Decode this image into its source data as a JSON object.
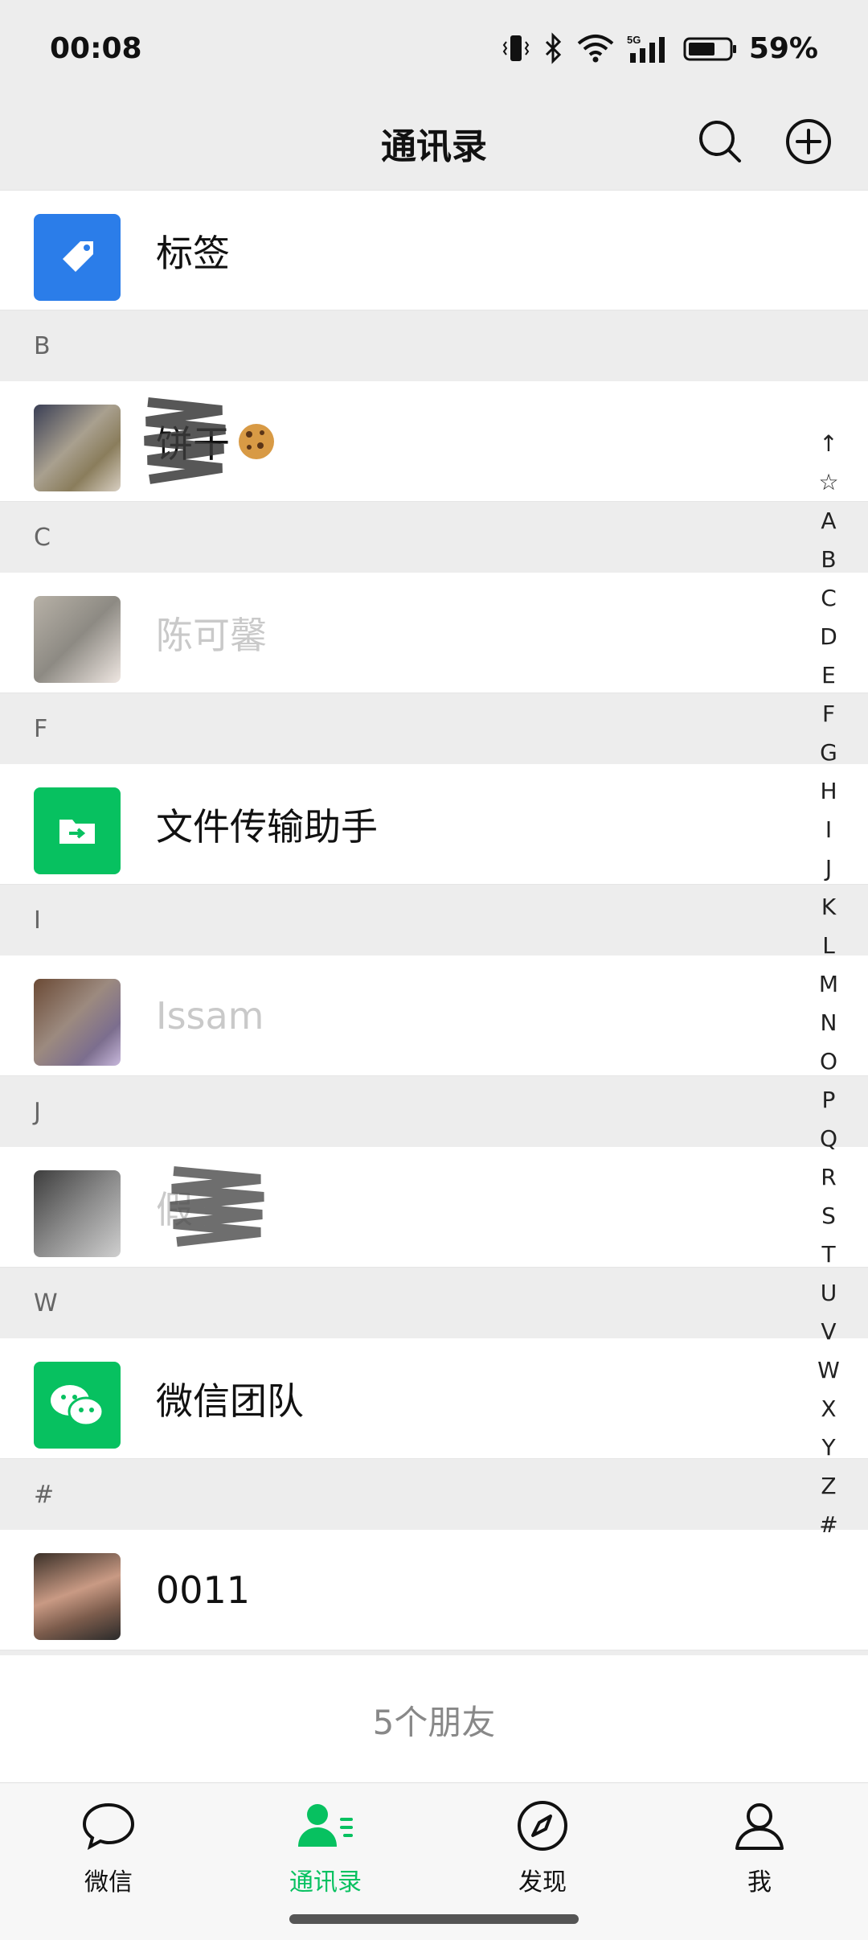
{
  "status_bar": {
    "time": "00:08",
    "network": "5G",
    "battery": "59%"
  },
  "nav": {
    "title": "通讯录"
  },
  "contacts": {
    "tags_label": "标签",
    "sections": [
      {
        "letter": "B",
        "name": "饼干"
      },
      {
        "letter": "C",
        "name": "陈可馨"
      },
      {
        "letter": "F",
        "name": "文件传输助手"
      },
      {
        "letter": "I",
        "name": "Issam"
      },
      {
        "letter": "J",
        "name": "假"
      },
      {
        "letter": "W",
        "name": "微信团队"
      },
      {
        "letter": "#",
        "name": "0011"
      }
    ],
    "friend_count": "5个朋友"
  },
  "index_bar": [
    "↑",
    "☆",
    "A",
    "B",
    "C",
    "D",
    "E",
    "F",
    "G",
    "H",
    "I",
    "J",
    "K",
    "L",
    "M",
    "N",
    "O",
    "P",
    "Q",
    "R",
    "S",
    "T",
    "U",
    "V",
    "W",
    "X",
    "Y",
    "Z",
    "#"
  ],
  "tabs": [
    {
      "label": "微信",
      "icon": "chat-bubble-icon"
    },
    {
      "label": "通讯录",
      "icon": "contacts-icon",
      "active": true
    },
    {
      "label": "发现",
      "icon": "compass-icon"
    },
    {
      "label": "我",
      "icon": "person-icon"
    }
  ],
  "colors": {
    "accent": "#07c160",
    "tag_blue": "#2b7de9",
    "background": "#ededed"
  }
}
